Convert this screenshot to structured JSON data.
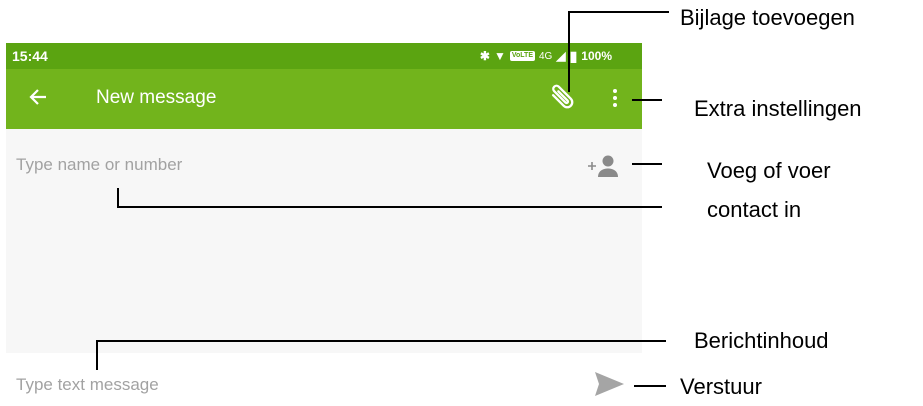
{
  "status_bar": {
    "time": "15:44",
    "network": "4G",
    "volte": "VoLTE",
    "battery": "100%"
  },
  "app_bar": {
    "title": "New message"
  },
  "recipient": {
    "placeholder": "Type name or number"
  },
  "compose": {
    "placeholder": "Type text message"
  },
  "icons": {
    "back": "arrow-back-icon",
    "attach": "paperclip-icon",
    "menu": "more-vert-icon",
    "add_contact": "add-contact-icon",
    "send": "send-icon"
  },
  "colors": {
    "status_bar": "#5ba411",
    "app_bar": "#72b41c",
    "recipient_area": "#f7f7f7",
    "placeholder": "#a2a2a2"
  },
  "callouts": {
    "attachment": "Bijlage toevoegen",
    "extra_settings": "Extra instellingen",
    "contact_line1": "Voeg of voer",
    "contact_line2": "contact in",
    "message_body": "Berichtinhoud",
    "send": "Verstuur"
  }
}
